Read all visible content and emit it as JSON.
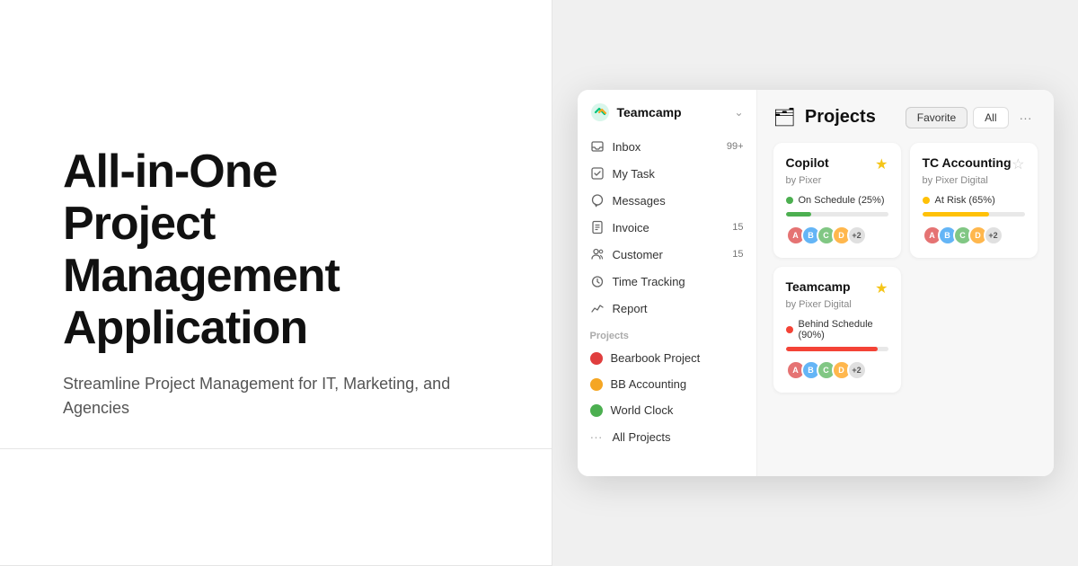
{
  "left": {
    "title_line1": "All-in-One",
    "title_line2": "Project Management",
    "title_line3": "Application",
    "subtitle": "Streamline Project Management for IT, Marketing, and Agencies"
  },
  "sidebar": {
    "brand": "Teamcamp",
    "nav_items": [
      {
        "id": "inbox",
        "label": "Inbox",
        "badge": "99+"
      },
      {
        "id": "my-task",
        "label": "My Task",
        "badge": ""
      },
      {
        "id": "messages",
        "label": "Messages",
        "badge": ""
      },
      {
        "id": "invoice",
        "label": "Invoice",
        "badge": "15"
      },
      {
        "id": "customer",
        "label": "Customer",
        "badge": "15"
      },
      {
        "id": "time-tracking",
        "label": "Time Tracking",
        "badge": ""
      },
      {
        "id": "report",
        "label": "Report",
        "badge": ""
      }
    ],
    "projects_section_label": "Projects",
    "project_items": [
      {
        "id": "bearbook",
        "label": "Bearbook Project",
        "color": "#e03e3e"
      },
      {
        "id": "bb-accounting",
        "label": "BB Accounting",
        "color": "#f5a623"
      },
      {
        "id": "world-clock",
        "label": "World Clock",
        "color": "#4caf50"
      },
      {
        "id": "all-projects",
        "label": "All Projects",
        "color": null
      }
    ]
  },
  "main": {
    "title": "Projects",
    "tab_favorite": "Favorite",
    "tab_all": "All",
    "projects": [
      {
        "id": "copilot",
        "title": "Copilot",
        "subtitle": "by Pixer",
        "status_label": "On Schedule (25%)",
        "status_color": "#4caf50",
        "progress": 25,
        "progress_color": "#4caf50",
        "starred": true,
        "avatars": [
          "#e57373",
          "#64b5f6",
          "#81c784",
          "#ffb74d"
        ],
        "avatar_more": "+2"
      },
      {
        "id": "tc-accounting",
        "title": "TC Accounting",
        "subtitle": "by Pixer Digital",
        "status_label": "At Risk (65%)",
        "status_color": "#ffc107",
        "progress": 65,
        "progress_color": "#ffc107",
        "starred": false,
        "avatars": [
          "#e57373",
          "#64b5f6",
          "#81c784",
          "#ffb74d"
        ],
        "avatar_more": "+2"
      },
      {
        "id": "teamcamp",
        "title": "Teamcamp",
        "subtitle": "by Pixer Digital",
        "status_label": "Behind Schedule (90%)",
        "status_color": "#f44336",
        "progress": 90,
        "progress_color": "#f44336",
        "starred": true,
        "avatars": [
          "#e57373",
          "#64b5f6",
          "#81c784",
          "#ffb74d"
        ],
        "avatar_more": "+2"
      }
    ]
  },
  "icons": {
    "star_filled": "★",
    "star_empty": "☆",
    "chevron_down": "⌄",
    "dots": "···"
  }
}
